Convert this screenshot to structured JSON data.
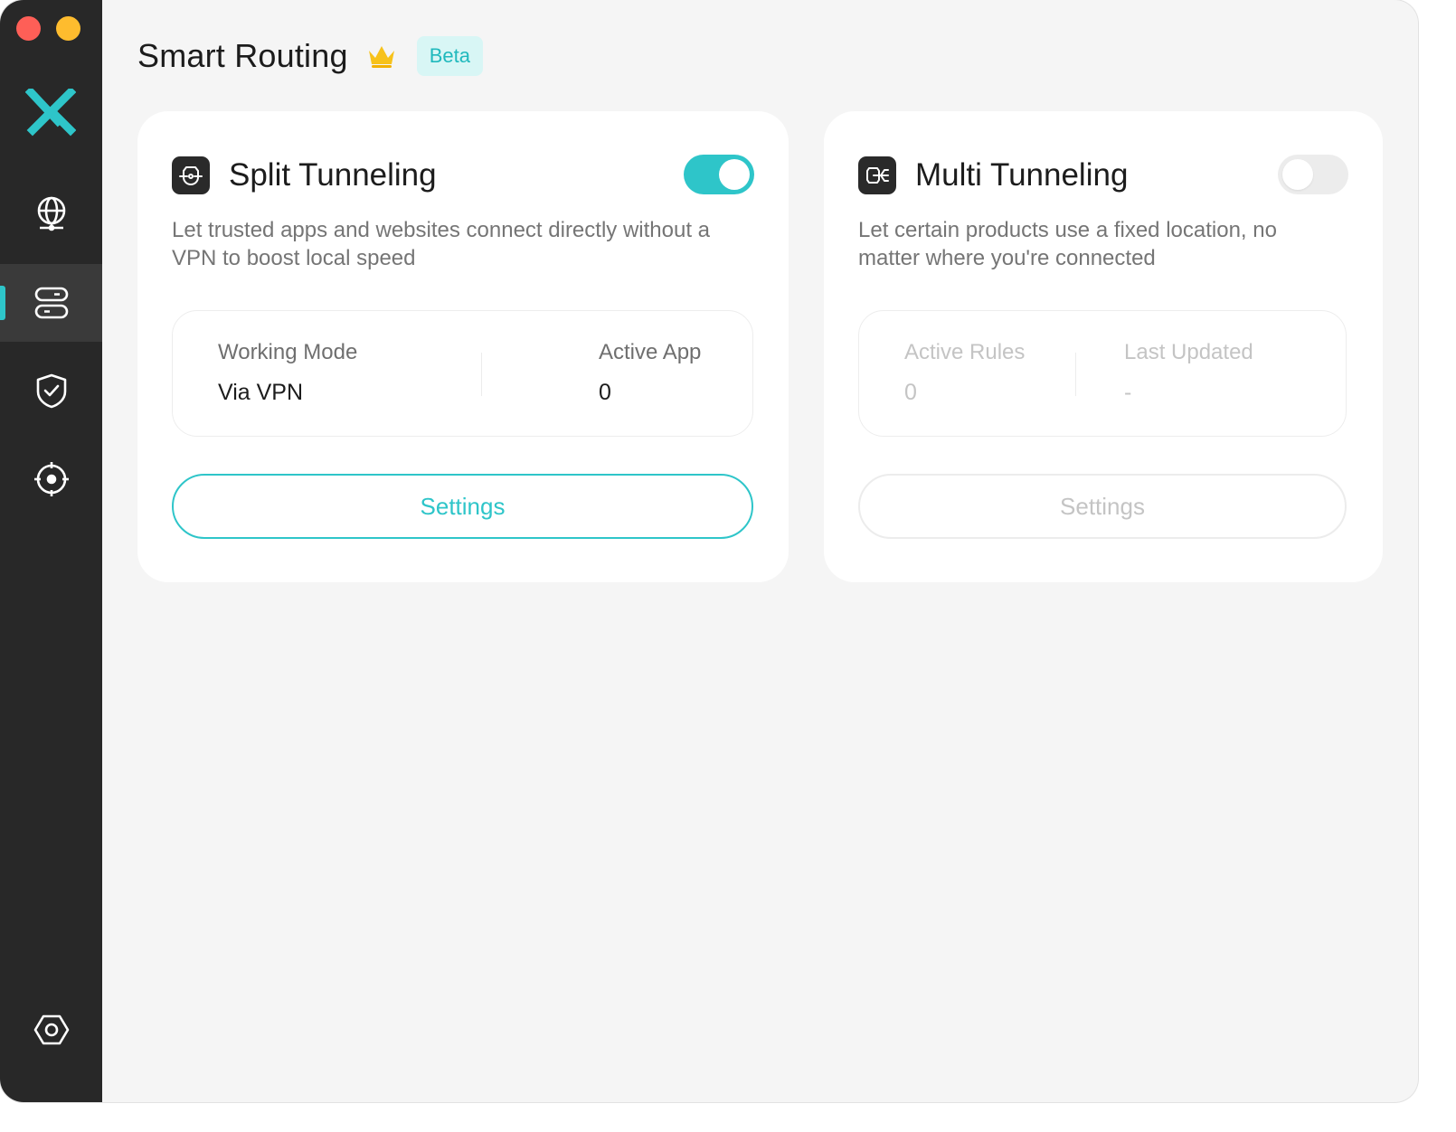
{
  "colors": {
    "accent": "#2ec5c9",
    "sidebar": "#282828",
    "beta_bg": "#d8f6f5"
  },
  "window_controls": {
    "close": "red",
    "minimize": "yellow"
  },
  "sidebar": {
    "logo": "app-logo",
    "items": [
      {
        "icon": "globe-icon",
        "name": "locations",
        "active": false
      },
      {
        "icon": "routing-icon",
        "name": "smart-routing",
        "active": true
      },
      {
        "icon": "shield-check-icon",
        "name": "security",
        "active": false
      },
      {
        "icon": "crosshair-icon",
        "name": "target",
        "active": false
      }
    ],
    "settings_icon": "gear-icon"
  },
  "header": {
    "title": "Smart Routing",
    "crown_icon": "crown-icon",
    "badge": "Beta"
  },
  "split_tunneling": {
    "icon": "split-tunnel-icon",
    "title": "Split Tunneling",
    "enabled": true,
    "description": "Let trusted apps and websites connect directly without a VPN to boost local speed",
    "stats": [
      {
        "label": "Working Mode",
        "value": "Via VPN"
      },
      {
        "label": "Active App",
        "value": "0"
      }
    ],
    "button": "Settings"
  },
  "multi_tunneling": {
    "icon": "multi-tunnel-icon",
    "title": "Multi Tunneling",
    "enabled": false,
    "description": "Let certain products use a fixed location, no matter where you're connected",
    "stats": [
      {
        "label": "Active Rules",
        "value": "0"
      },
      {
        "label": "Last Updated",
        "value": "-"
      }
    ],
    "button": "Settings"
  }
}
